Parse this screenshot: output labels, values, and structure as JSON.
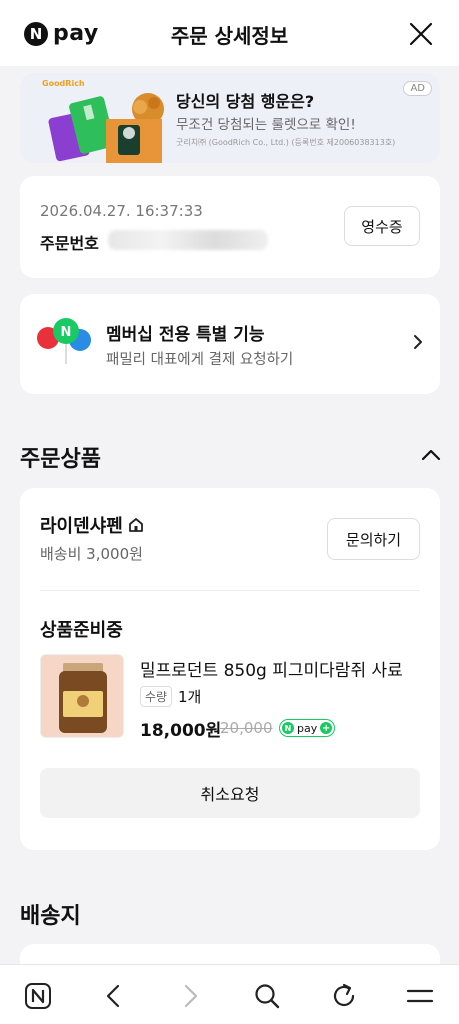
{
  "header": {
    "brand": "pay",
    "brand_mark": "N",
    "title": "주문 상세정보",
    "close_icon": "close-icon"
  },
  "ad": {
    "brand": "GoodRich",
    "headline": "당신의 당첨 행운은?",
    "sub": "무조건 당첨되는 룰렛으로 확인!",
    "small": "굿리치㈜ (GoodRich Co., Ltd.) (등록번호 제2006038313호)",
    "badge": "AD"
  },
  "order": {
    "datetime": "2026.04.27. 16:37:33",
    "number_label": "주문번호",
    "receipt_button": "영수증"
  },
  "membership": {
    "title": "멤버십 전용 특별 기능",
    "sub": "패밀리 대표에게 결제 요청하기"
  },
  "sections": {
    "order_products": "주문상품",
    "shipping": "배송지"
  },
  "seller": {
    "name": "라이덴샤펜",
    "shipping_fee": "배송비 3,000원",
    "inquiry_button": "문의하기"
  },
  "item": {
    "status": "상품준비중",
    "name": "밀프로던트 850g 피그미다람쥐 사료",
    "qty_label": "수량",
    "qty_value": "1개",
    "price": "18,000원",
    "original_price": "20,000",
    "npay_text": "pay",
    "cancel_button": "취소요청"
  },
  "colors": {
    "npay_green": "#18c964",
    "background": "#f3f3f5"
  },
  "bottom_nav": [
    "naver-home-icon",
    "back-icon",
    "forward-icon",
    "search-icon",
    "refresh-icon",
    "menu-icon"
  ]
}
